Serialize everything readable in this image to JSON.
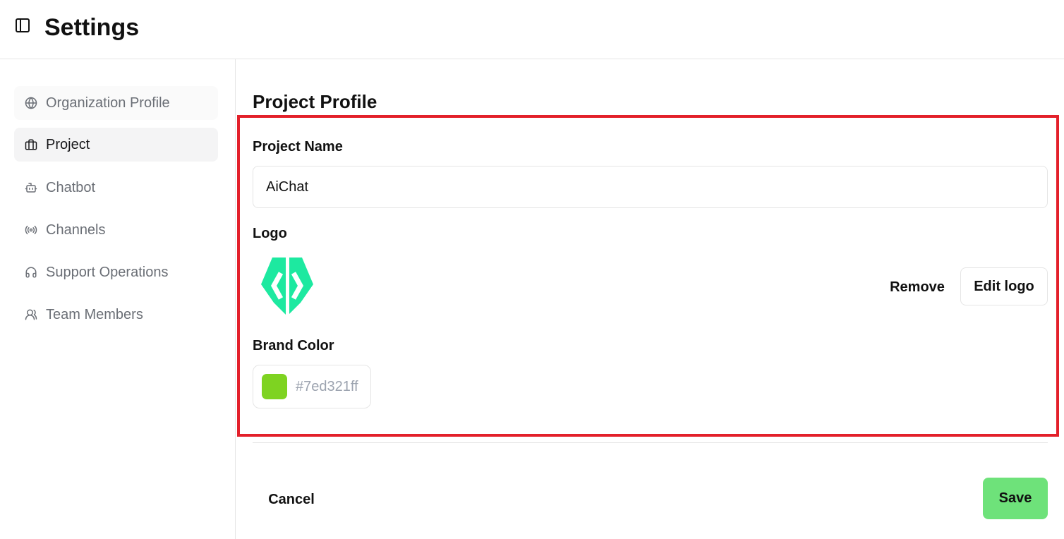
{
  "header": {
    "title": "Settings",
    "toggle_icon": "sidebar-panel-icon"
  },
  "sidebar": {
    "items": [
      {
        "label": "Organization Profile",
        "icon": "globe-icon",
        "active": false
      },
      {
        "label": "Project",
        "icon": "briefcase-icon",
        "active": true
      },
      {
        "label": "Chatbot",
        "icon": "bot-icon",
        "active": false
      },
      {
        "label": "Channels",
        "icon": "radio-broadcast-icon",
        "active": false
      },
      {
        "label": "Support Operations",
        "icon": "headset-icon",
        "active": false
      },
      {
        "label": "Team Members",
        "icon": "users-icon",
        "active": false
      }
    ]
  },
  "main": {
    "section_title": "Project Profile",
    "project_name": {
      "label": "Project Name",
      "value": "AiChat"
    },
    "logo": {
      "label": "Logo",
      "remove_label": "Remove",
      "edit_label": "Edit logo"
    },
    "brand_color": {
      "label": "Brand Color",
      "value": "#7ed321ff"
    },
    "actions": {
      "cancel_label": "Cancel",
      "save_label": "Save"
    }
  },
  "colors": {
    "swatch": "#7ed321",
    "logo": "#1de9a0",
    "save_bg": "#6ee27a",
    "highlight_border": "#e3202a"
  }
}
